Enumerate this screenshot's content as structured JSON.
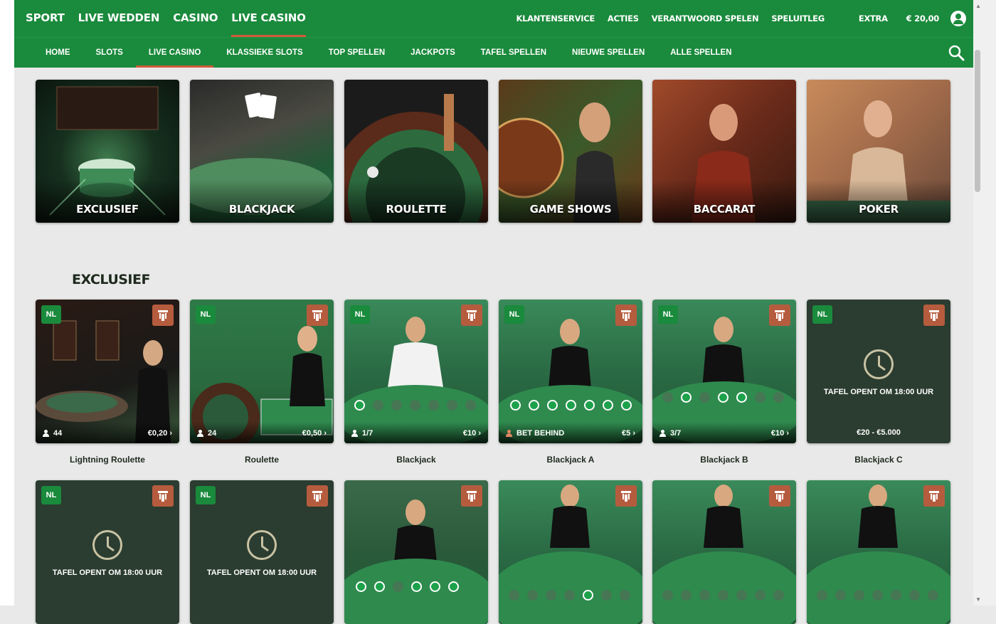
{
  "main_nav": [
    "SPORT",
    "LIVE WEDDEN",
    "CASINO",
    "LIVE CASINO"
  ],
  "top_links": [
    "KLANTENSERVICE",
    "ACTIES",
    "VERANTWOORD SPELEN",
    "SPELUITLEG"
  ],
  "extra_label": "EXTRA",
  "balance": "€ 20,00",
  "sub_nav": [
    "HOME",
    "SLOTS",
    "LIVE CASINO",
    "KLASSIEKE SLOTS",
    "TOP SPELLEN",
    "JACKPOTS",
    "TAFEL SPELLEN",
    "NIEUWE SPELLEN",
    "ALLE SPELLEN"
  ],
  "categories": [
    "EXCLUSIEF",
    "BLACKJACK",
    "ROULETTE",
    "GAME SHOWS",
    "BACCARAT",
    "POKER"
  ],
  "section_title": "EXCLUSIEF",
  "games_row1": [
    {
      "name": "Lightning Roulette",
      "players": "44",
      "stake": "€0,20"
    },
    {
      "name": "Roulette",
      "players": "24",
      "stake": "€0,50"
    },
    {
      "name": "Blackjack",
      "players": "1/7",
      "stake": "€10"
    },
    {
      "name": "Blackjack A",
      "players": "BET BEHIND",
      "stake": "€5"
    },
    {
      "name": "Blackjack B",
      "players": "3/7",
      "stake": "€10"
    },
    {
      "name": "Blackjack C",
      "closed_text": "TAFEL OPENT OM 18:00 UUR",
      "limits": "€20 - €5.000"
    }
  ],
  "games_row2": [
    {
      "closed_text": "TAFEL OPENT OM 18:00 UUR"
    },
    {
      "closed_text": "TAFEL OPENT OM 18:00 UUR"
    }
  ],
  "badge_label": "NL"
}
